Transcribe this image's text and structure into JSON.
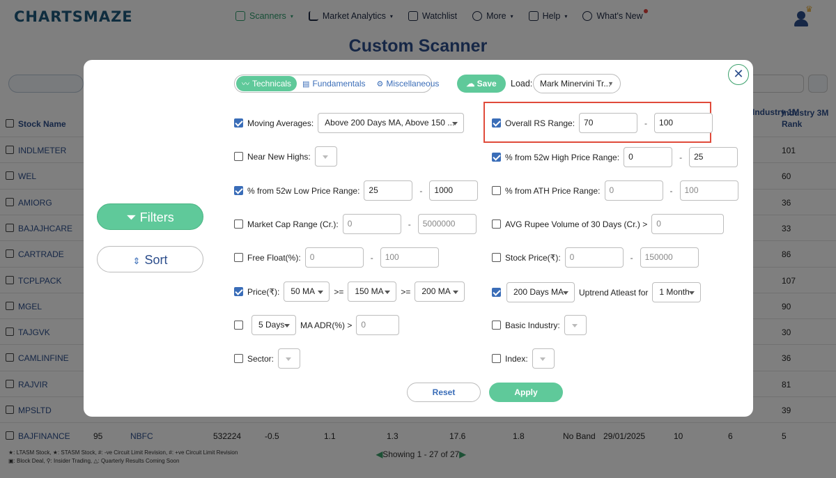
{
  "brand": {
    "logo": "CHARTSMAZE"
  },
  "nav": {
    "items": [
      {
        "label": "Scanners",
        "caret": "▾"
      },
      {
        "label": "Market Analytics",
        "caret": "▾"
      },
      {
        "label": "Watchlist"
      },
      {
        "label": "More",
        "caret": "▾"
      },
      {
        "label": "Help",
        "caret": "▾"
      },
      {
        "label": "What's New"
      }
    ]
  },
  "page": {
    "title": "Custom Scanner"
  },
  "table": {
    "header_stock_name": "Stock Name",
    "header_industry_1m": "Industry 1M",
    "header_industry_3m_rank": "Industry 3M Rank",
    "rows": [
      {
        "name": "INDLMETER",
        "rank": "101"
      },
      {
        "name": "WEL",
        "rank": "60"
      },
      {
        "name": "AMIORG",
        "rank": "36"
      },
      {
        "name": "BAJAJHCARE",
        "rank": "33"
      },
      {
        "name": "CARTRADE",
        "rank": "86"
      },
      {
        "name": "TCPLPACK",
        "rank": "107"
      },
      {
        "name": "MGEL",
        "rank": "90"
      },
      {
        "name": "TAJGVK",
        "rank": "30"
      },
      {
        "name": "CAMLINFINE",
        "rank": "36"
      },
      {
        "name": "RAJVIR",
        "rank": "81"
      },
      {
        "name": "MPSLTD",
        "rank": "39"
      },
      {
        "name": "BAJFINANCE",
        "rank": "5"
      }
    ],
    "last_row_extra": {
      "c1": "95",
      "c2": "NBFC",
      "c3": "532224",
      "c4": "-0.5",
      "c5": "1.1",
      "c6": "1.3",
      "c7": "17.6",
      "c8": "1.8",
      "c9": "No Band",
      "c10": "29/01/2025",
      "c11": "10",
      "c12": "6"
    },
    "legend_line1": "★: LTASM Stock, ★: STASM Stock, #: -ve Circuit Limit Revision, #: +ve Circuit Limit Revision",
    "legend_line2": "▣: Block Deal, ⚲: Insider Trading, △: Quarterly Results Coming Soon",
    "pager": "Showing 1 - 27 of 27"
  },
  "modal": {
    "tabs": [
      {
        "label": "Technicals",
        "active": true
      },
      {
        "label": "Fundamentals"
      },
      {
        "label": "Miscellaneous"
      }
    ],
    "save_label": "Save",
    "load_label": "Load:",
    "load_value": "Mark Minervini Tr...",
    "side_filters": "Filters",
    "side_sort": "Sort",
    "left": {
      "moving_averages": {
        "label": "Moving Averages:",
        "value": "Above 200 Days MA, Above 150 ...",
        "checked": true
      },
      "near_new_highs": {
        "label": "Near New Highs:",
        "checked": false
      },
      "low_price_range": {
        "label": "% from 52w Low Price Range:",
        "min": "25",
        "max": "1000",
        "checked": true
      },
      "market_cap": {
        "label": "Market Cap Range (Cr.):",
        "min": "0",
        "max": "5000000",
        "checked": false
      },
      "free_float": {
        "label": "Free Float(%):",
        "min": "0",
        "max": "100",
        "checked": false
      },
      "price": {
        "label": "Price(₹):",
        "ma1": "50 MA",
        "op1": ">=",
        "ma2": "150 MA",
        "op2": ">=",
        "ma3": "200 MA",
        "checked": true
      },
      "ma_adr": {
        "period": "5 Days",
        "label": "MA ADR(%) >",
        "value": "0",
        "checked": false
      },
      "sector": {
        "label": "Sector:",
        "checked": false
      }
    },
    "right": {
      "overall_rs": {
        "label": "Overall RS Range:",
        "min": "70",
        "max": "100",
        "checked": true
      },
      "high_price_range": {
        "label": "% from 52w High Price Range:",
        "min": "0",
        "max": "25",
        "checked": true
      },
      "ath_range": {
        "label": "% from ATH Price Range:",
        "min": "0",
        "max": "100",
        "checked": false
      },
      "avg_rupee_volume": {
        "label": "AVG Rupee Volume of 30 Days (Cr.) >",
        "value": "0",
        "checked": false
      },
      "stock_price": {
        "label": "Stock Price(₹):",
        "min": "0",
        "max": "150000",
        "checked": false
      },
      "uptrend": {
        "ma": "200 Days MA",
        "label": "Uptrend Atleast for",
        "period": "1 Month",
        "checked": true
      },
      "basic_industry": {
        "label": "Basic Industry:",
        "checked": false
      },
      "index": {
        "label": "Index:",
        "checked": false
      }
    },
    "dash": "-",
    "reset_label": "Reset",
    "apply_label": "Apply",
    "close_glyph": "✕",
    "highlight_color": "#e04a3a",
    "accent_color": "#5fc99a"
  }
}
